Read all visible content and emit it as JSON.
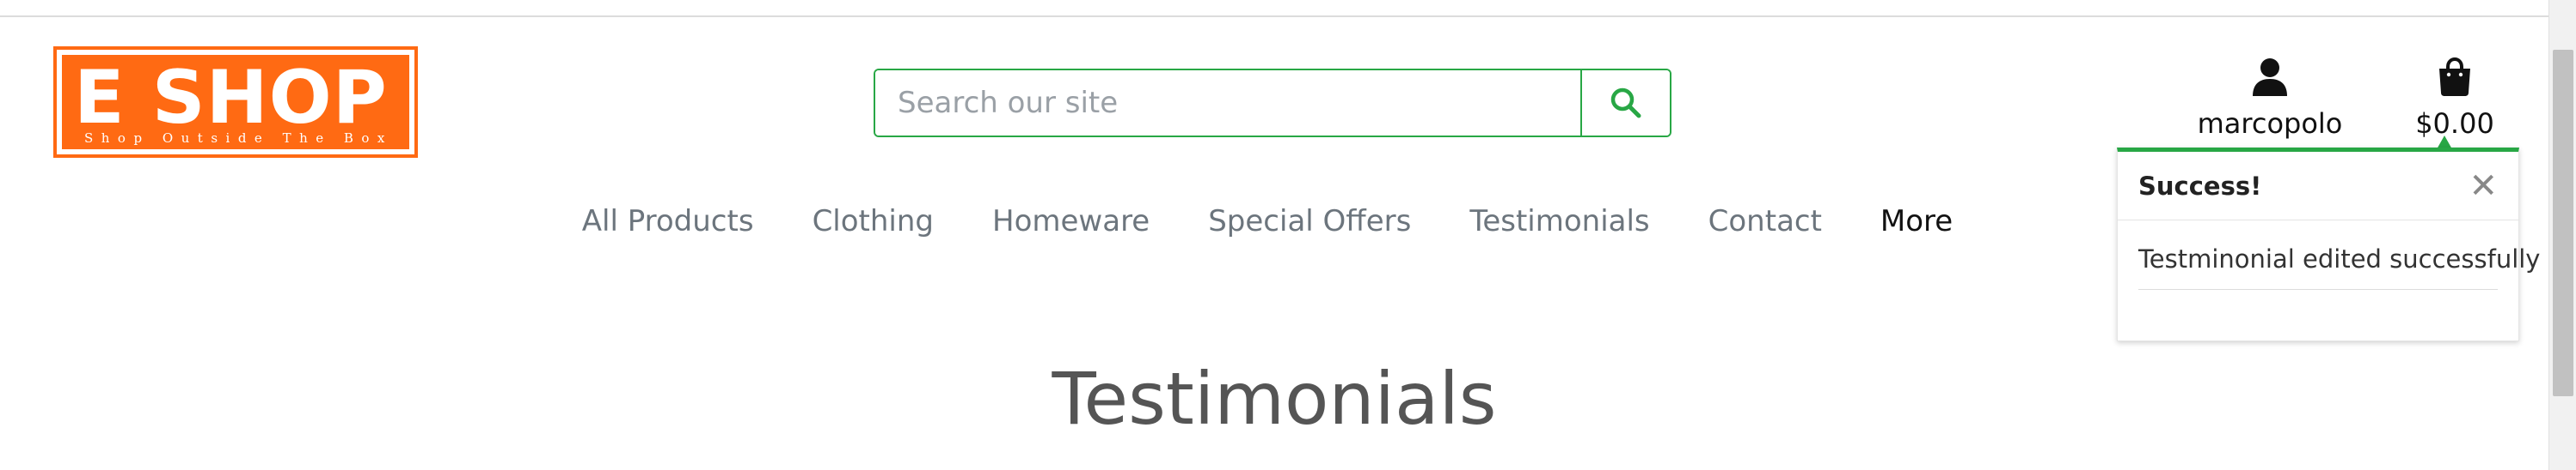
{
  "logo": {
    "title": "E SHOP",
    "tagline": "Shop Outside The Box",
    "color": "#ff6a13"
  },
  "search": {
    "placeholder": "Search our site",
    "icon": "search-icon",
    "accent": "#28a745"
  },
  "account": {
    "username": "marcopolo",
    "icon": "user-icon"
  },
  "bag": {
    "total": "$0.00",
    "icon": "shopping-bag-icon"
  },
  "nav": {
    "items": [
      "All Products",
      "Clothing",
      "Homeware",
      "Special Offers",
      "Testimonials",
      "Contact",
      "More"
    ]
  },
  "toast": {
    "title": "Success!",
    "close": "✕",
    "message": "Testminonial edited successfully",
    "accent": "#28a745"
  },
  "page": {
    "title": "Testimonials"
  }
}
